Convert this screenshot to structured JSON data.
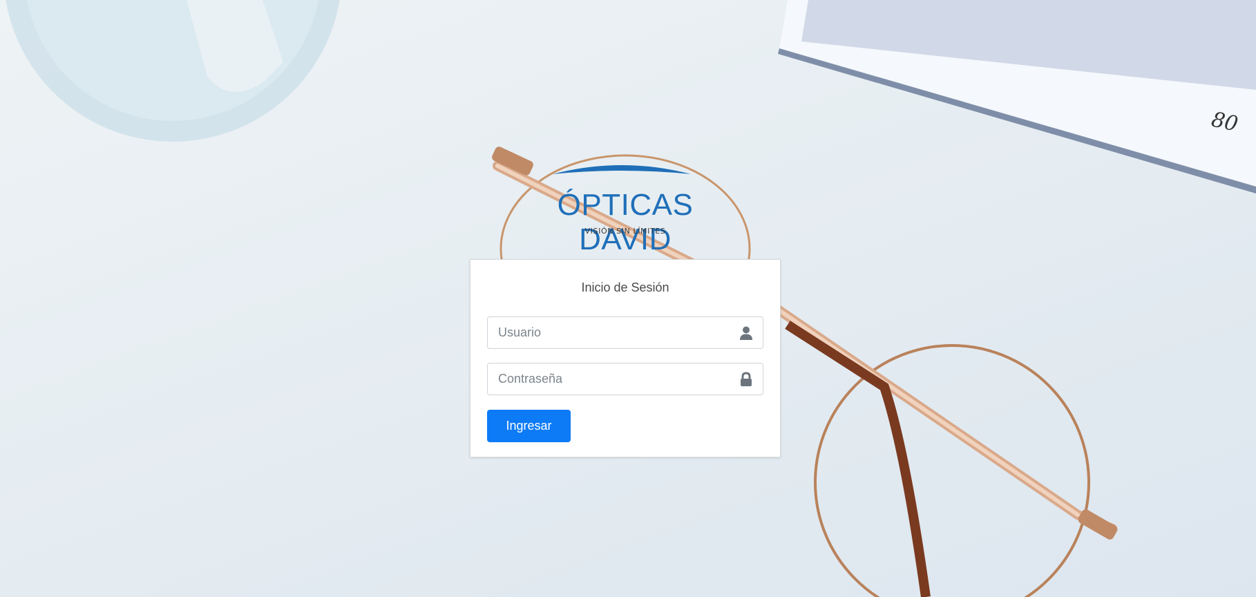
{
  "brand": {
    "name": "ÓPTICAS DAVID",
    "tagline": "VISIÓN SIN LÍMITES",
    "color": "#1f6fb8"
  },
  "login": {
    "title": "Inicio de Sesión",
    "username": {
      "placeholder": "Usuario",
      "value": "",
      "icon": "user-icon"
    },
    "password": {
      "placeholder": "Contraseña",
      "value": "",
      "icon": "lock-icon"
    },
    "submit_label": "Ingresar",
    "submit_color": "#0d7bf6"
  },
  "background": {
    "page_number": "80"
  }
}
